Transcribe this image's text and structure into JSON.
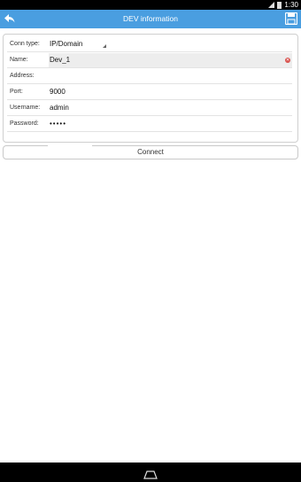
{
  "status_bar": {
    "time": "1:30"
  },
  "header": {
    "title": "DEV information",
    "back_icon": "back-arrow-icon",
    "save_icon": "save-floppy-icon"
  },
  "form": {
    "conn_type": {
      "label": "Conn type:",
      "value": "IP/Domain"
    },
    "name": {
      "label": "Name:",
      "value": "Dev_1"
    },
    "address": {
      "label": "Address:",
      "value": ""
    },
    "port": {
      "label": "Port:",
      "value": "9000"
    },
    "username": {
      "label": "Username:",
      "value": "admin"
    },
    "password": {
      "label": "Password:",
      "value": "•••••"
    }
  },
  "connect_label": "Connect",
  "colors": {
    "accent": "#4a9ee0",
    "clear_icon": "#d9534f"
  }
}
